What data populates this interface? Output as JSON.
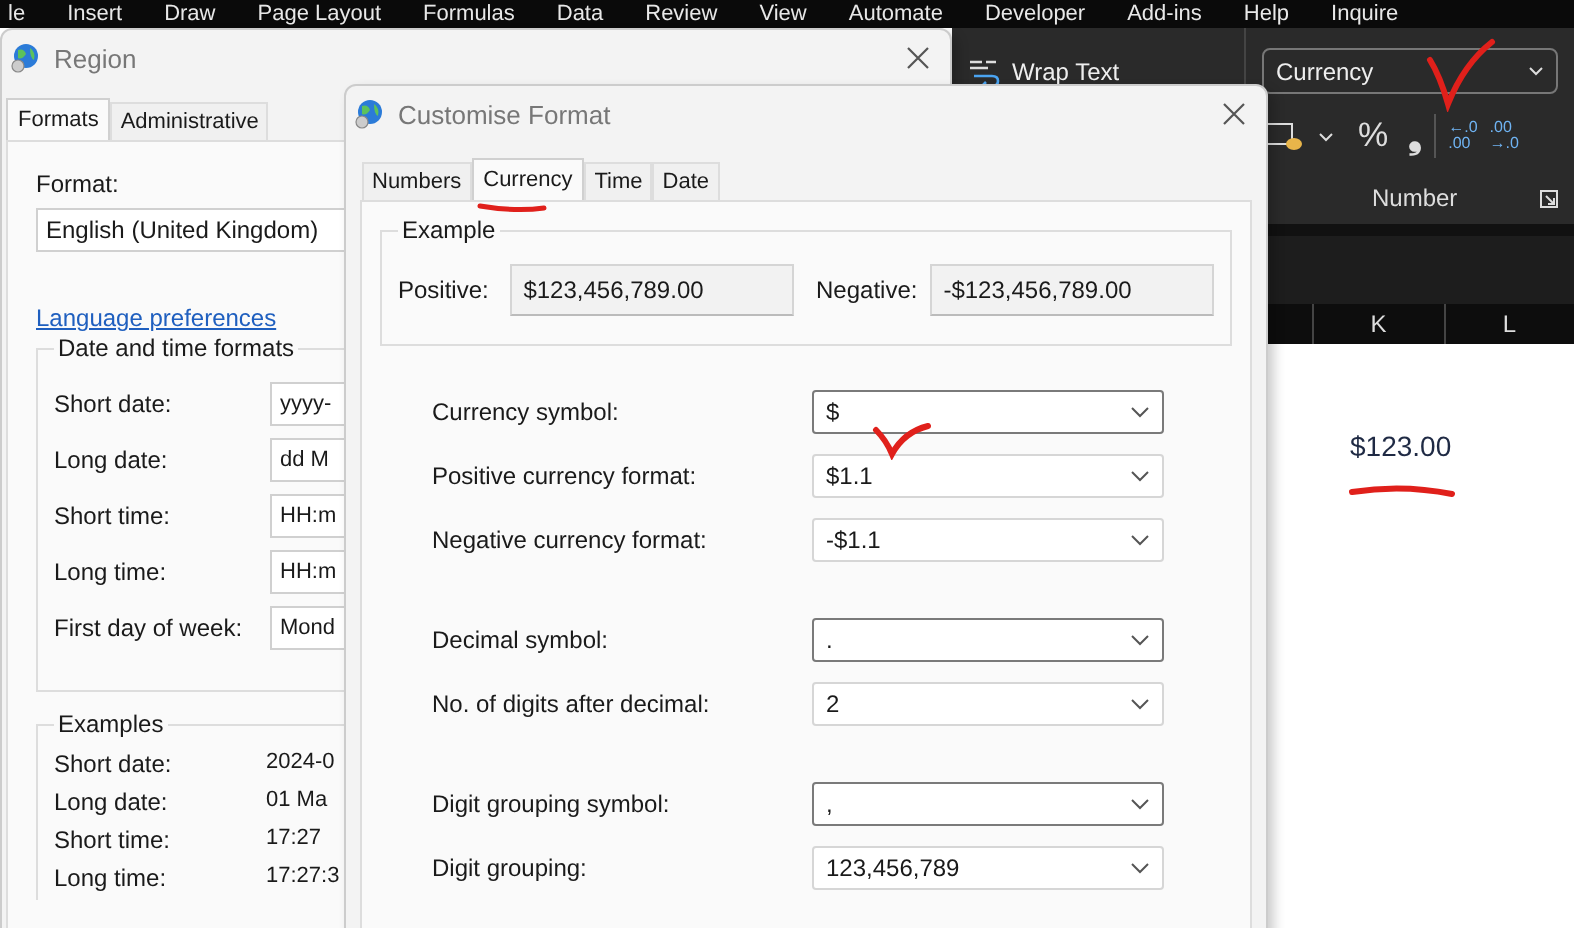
{
  "ribbon_tabs": [
    "le",
    "Insert",
    "Draw",
    "Page Layout",
    "Formulas",
    "Data",
    "Review",
    "View",
    "Automate",
    "Developer",
    "Add-ins",
    "Help",
    "Inquire"
  ],
  "ribbon": {
    "wrap_text": "Wrap Text",
    "number_format": "Currency",
    "percent": "%",
    "comma": "❟",
    "increase_decimal": {
      "top": "←.0",
      "bottom": ".00"
    },
    "decrease_decimal": {
      "top": ".00",
      "bottom": "→.0"
    },
    "group_label": "Number"
  },
  "sheet": {
    "columns": [
      "K",
      "L"
    ],
    "cell_value": "$123.00"
  },
  "region_dialog": {
    "title": "Region",
    "tabs": [
      {
        "label": "Formats",
        "selected": true
      },
      {
        "label": "Administrative",
        "selected": false
      }
    ],
    "format_label": "Format:",
    "format_value": "English (United Kingdom)",
    "link": "Language preferences",
    "date_time_group": {
      "title": "Date and time formats",
      "rows": [
        {
          "label": "Short date:",
          "value": "yyyy-"
        },
        {
          "label": "Long date:",
          "value": "dd M"
        },
        {
          "label": "Short time:",
          "value": "HH:m"
        },
        {
          "label": "Long time:",
          "value": "HH:m"
        },
        {
          "label": "First day of week:",
          "value": "Mond"
        }
      ]
    },
    "examples_group": {
      "title": "Examples",
      "rows": [
        {
          "label": "Short date:",
          "value": "2024-0"
        },
        {
          "label": "Long date:",
          "value": "01 Ma"
        },
        {
          "label": "Short time:",
          "value": "17:27"
        },
        {
          "label": "Long time:",
          "value": "17:27:3"
        }
      ]
    }
  },
  "customise_dialog": {
    "title": "Customise Format",
    "tabs": [
      {
        "label": "Numbers",
        "selected": false
      },
      {
        "label": "Currency",
        "selected": true
      },
      {
        "label": "Time",
        "selected": false
      },
      {
        "label": "Date",
        "selected": false
      }
    ],
    "example": {
      "title": "Example",
      "positive_label": "Positive:",
      "positive_value": "$123,456,789.00",
      "negative_label": "Negative:",
      "negative_value": "-$123,456,789.00"
    },
    "setting_groups": [
      [
        {
          "label": "Currency symbol:",
          "value": "$",
          "editable": true
        },
        {
          "label": "Positive currency format:",
          "value": "$1.1",
          "editable": false
        },
        {
          "label": "Negative currency format:",
          "value": "-$1.1",
          "editable": false
        }
      ],
      [
        {
          "label": "Decimal symbol:",
          "value": ".",
          "editable": true
        },
        {
          "label": "No. of digits after decimal:",
          "value": "2",
          "editable": false
        }
      ],
      [
        {
          "label": "Digit grouping symbol:",
          "value": ",",
          "editable": true
        },
        {
          "label": "Digit grouping:",
          "value": "123,456,789",
          "editable": false
        }
      ]
    ]
  }
}
